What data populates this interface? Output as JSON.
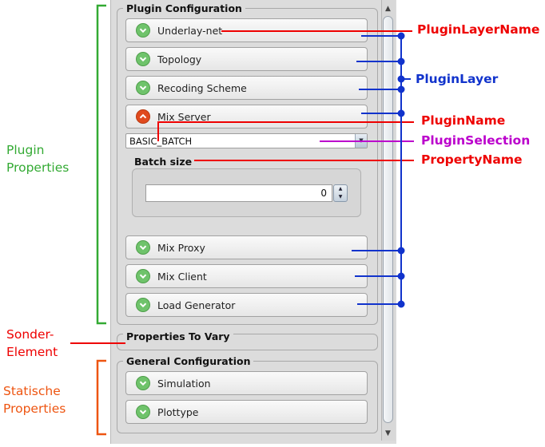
{
  "panel": {
    "plugin_group_title": "Plugin Configuration",
    "plugins": [
      {
        "label": "Underlay-net",
        "state": "collapsed"
      },
      {
        "label": "Topology",
        "state": "collapsed"
      },
      {
        "label": "Recoding Scheme",
        "state": "collapsed"
      },
      {
        "label": "Mix Server",
        "state": "expanded"
      },
      {
        "label": "Mix Proxy",
        "state": "collapsed"
      },
      {
        "label": "Mix Client",
        "state": "collapsed"
      },
      {
        "label": "Load Generator",
        "state": "collapsed"
      }
    ],
    "plugin_selection": "BASIC_BATCH",
    "property_name": "Batch size",
    "property_value": "0",
    "vary_group_title": "Properties To Vary",
    "general_group_title": "General Configuration",
    "general_items": [
      {
        "label": "Simulation"
      },
      {
        "label": "Plottype"
      }
    ]
  },
  "annotations": {
    "plugin_layer_name": "PluginLayerName",
    "plugin_layer": "PluginLayer",
    "plugin_name": "PluginName",
    "plugin_selection": "PluginSelection",
    "property_name": "PropertyName",
    "plugin_properties": [
      "Plugin",
      "Properties"
    ],
    "sonder_element": [
      "Sonder-",
      "Element"
    ],
    "statische_properties": [
      "Statische",
      "Properties"
    ]
  },
  "colors": {
    "red": "#ee0000",
    "blue": "#1133cc",
    "purple": "#bb00cc",
    "green": "#33aa33",
    "orange": "#ee5511",
    "expand_green": "#6fc36b",
    "collapse_red": "#e04a1e"
  }
}
